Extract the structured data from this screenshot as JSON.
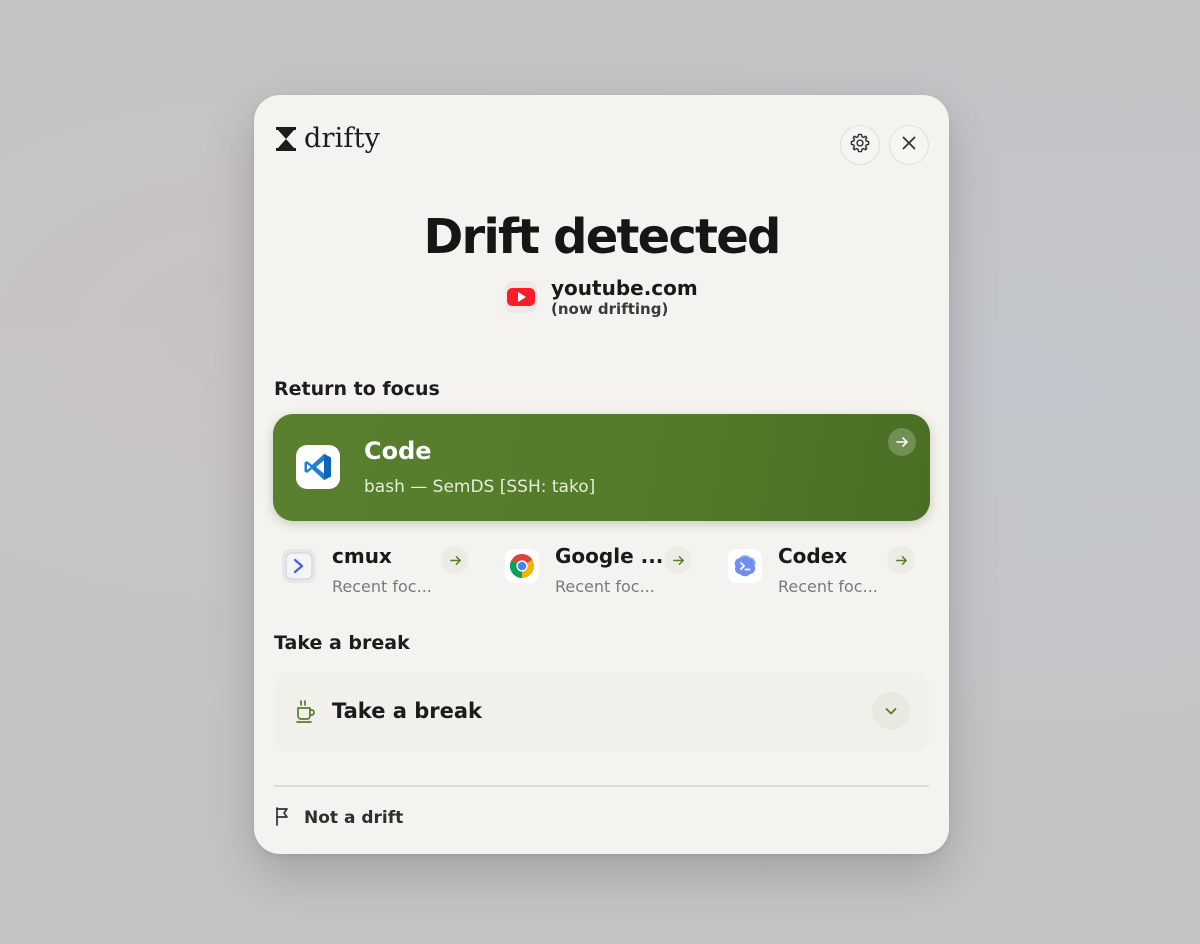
{
  "app": {
    "name": "drifty",
    "logo_icon": "hourglass-icon"
  },
  "header": {
    "settings_icon": "gear-icon",
    "close_icon": "close-icon"
  },
  "alert": {
    "title": "Drift detected",
    "site_name": "youtube.com",
    "site_status": "(now drifting)",
    "site_icon": "youtube-icon"
  },
  "focus": {
    "section_label": "Return to focus",
    "primary": {
      "app": "Code",
      "subtitle": "bash — SemDS [SSH: tako]",
      "icon": "vscode-icon",
      "accent": "#567d2d"
    },
    "recent": [
      {
        "app": "cmux",
        "subtitle": "Recent foc...",
        "icon": "terminal-icon"
      },
      {
        "app": "Google ...",
        "subtitle": "Recent foc...",
        "icon": "chrome-icon"
      },
      {
        "app": "Codex",
        "subtitle": "Recent foc...",
        "icon": "codex-icon"
      }
    ]
  },
  "break": {
    "section_label": "Take a break",
    "option_label": "Take a break",
    "icon": "coffee-cup-icon"
  },
  "footer": {
    "not_drift_label": "Not a drift",
    "icon": "flag-icon"
  }
}
